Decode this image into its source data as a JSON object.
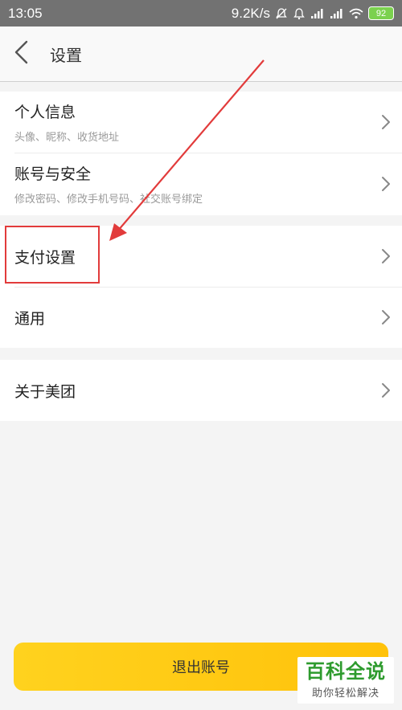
{
  "status_bar": {
    "time": "13:05",
    "speed": "9.2K/s",
    "battery": "92",
    "icons": [
      "mute-bell-icon",
      "alarm-icon",
      "signal-icon",
      "signal-icon",
      "wifi-icon",
      "battery-icon"
    ]
  },
  "header": {
    "back_icon": "chevron-left-icon",
    "title": "设置"
  },
  "groups": [
    {
      "items": [
        {
          "title": "个人信息",
          "subtitle": "头像、昵称、收货地址"
        },
        {
          "title": "账号与安全",
          "subtitle": "修改密码、修改手机号码、社交账号绑定"
        }
      ]
    },
    {
      "items": [
        {
          "title": "支付设置"
        },
        {
          "title": "通用"
        }
      ]
    },
    {
      "items": [
        {
          "title": "关于美团"
        }
      ]
    }
  ],
  "logout_label": "退出账号",
  "annotation": {
    "highlight_color": "#e23b3b",
    "highlighted_item": "支付设置"
  },
  "watermark": {
    "main": "百科全说",
    "sub": "助你轻松解决"
  },
  "colors": {
    "accent": "#ffc20a",
    "background": "#f4f4f4",
    "status_bar": "#727272"
  }
}
